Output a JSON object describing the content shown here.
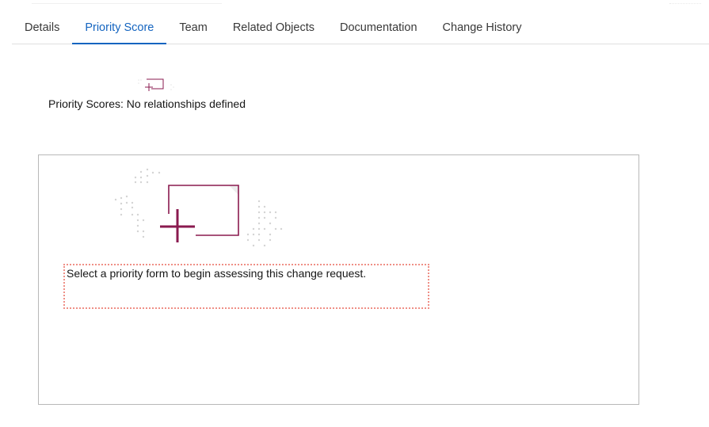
{
  "tabs": [
    {
      "label": "Details",
      "active": false
    },
    {
      "label": "Priority Score",
      "active": true
    },
    {
      "label": "Team",
      "active": false
    },
    {
      "label": "Related Objects",
      "active": false
    },
    {
      "label": "Documentation",
      "active": false
    },
    {
      "label": "Change History",
      "active": false
    }
  ],
  "priority": {
    "label": "Priority Scores: No relationships defined"
  },
  "empty_state": {
    "icon": "add-form-illustration-icon",
    "message": "Select a priority form to begin assessing this change request."
  },
  "colors": {
    "accent": "#1565c0",
    "illustration": "#8a1a4f",
    "message_border": "#ef8f86",
    "panel_border": "#b8b8b8"
  }
}
